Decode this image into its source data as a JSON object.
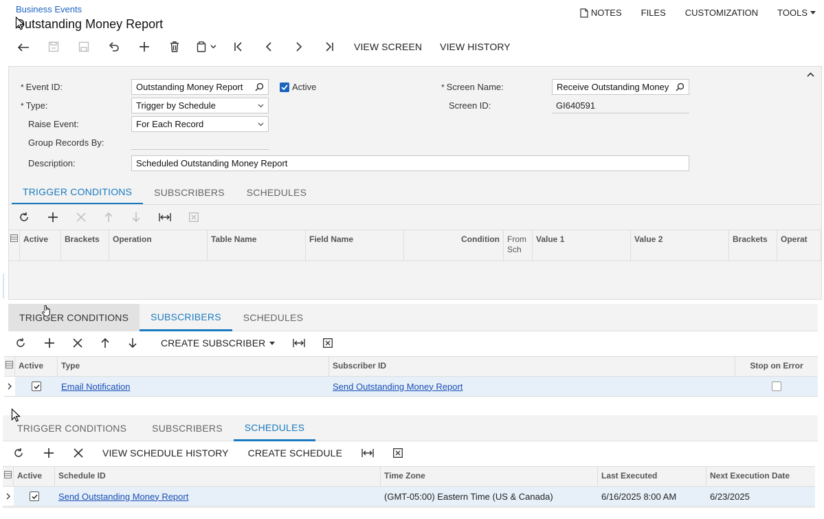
{
  "header": {
    "breadcrumb": "Business Events",
    "title": "Outstanding Money Report",
    "nav": {
      "notes": "NOTES",
      "files": "FILES",
      "customization": "CUSTOMIZATION",
      "tools": "TOOLS"
    }
  },
  "toolbar": {
    "view_screen": "VIEW SCREEN",
    "view_history": "VIEW HISTORY"
  },
  "form": {
    "event_id_label": "Event ID:",
    "event_id_value": "Outstanding Money Report",
    "active_label": "Active",
    "type_label": "Type:",
    "type_value": "Trigger by Schedule",
    "raise_event_label": "Raise Event:",
    "raise_event_value": "For Each Record",
    "group_records_label": "Group Records By:",
    "description_label": "Description:",
    "description_value": "Scheduled Outstanding Money Report",
    "screen_name_label": "Screen Name:",
    "screen_name_value": "Receive Outstanding Money",
    "screen_id_label": "Screen ID:",
    "screen_id_value": "GI640591",
    "required_mark": "*"
  },
  "tabs": {
    "trigger": "TRIGGER CONDITIONS",
    "subscribers": "SUBSCRIBERS",
    "schedules": "SCHEDULES"
  },
  "trigger_grid": {
    "columns": [
      "Active",
      "Brackets",
      "Operation",
      "Table Name",
      "Field Name",
      "Condition",
      "From Sch",
      "Value 1",
      "Value 2",
      "Brackets",
      "Operat"
    ]
  },
  "subscribers": {
    "create_subscriber": "CREATE SUBSCRIBER",
    "columns": {
      "active": "Active",
      "type": "Type",
      "subscriber_id": "Subscriber ID",
      "stop_on_error": "Stop on Error"
    },
    "rows": [
      {
        "type": "Email Notification",
        "subscriber_id": "Send Outstanding Money Report"
      }
    ]
  },
  "schedules": {
    "view_schedule_history": "VIEW SCHEDULE HISTORY",
    "create_schedule": "CREATE SCHEDULE",
    "columns": {
      "active": "Active",
      "schedule_id": "Schedule ID",
      "time_zone": "Time Zone",
      "last_executed": "Last Executed",
      "next_execution": "Next Execution Date"
    },
    "rows": [
      {
        "schedule_id": "Send Outstanding Money Report",
        "time_zone": "(GMT-05:00) Eastern Time (US & Canada)",
        "last_executed": "6/16/2025 8:00 AM",
        "next_execution": "6/23/2025"
      }
    ]
  },
  "colors": {
    "accent": "#1a7ac0",
    "link": "#1a4eb5",
    "row_highlight": "#e7f0f9",
    "panel": "#f3f3f3"
  }
}
